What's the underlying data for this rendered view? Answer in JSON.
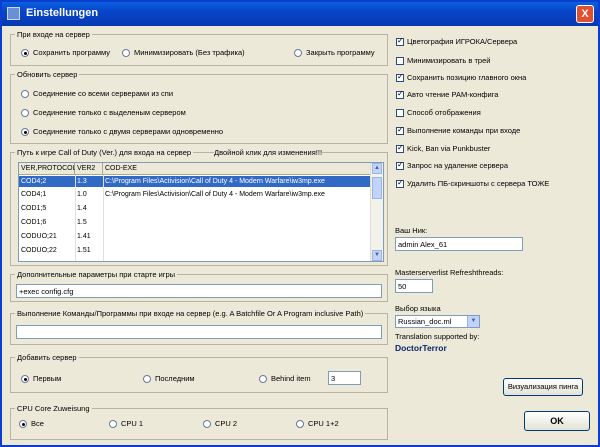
{
  "window": {
    "title": "Einstellungen",
    "close_label": "X"
  },
  "join_group": {
    "legend": "При входе на сервер",
    "options": [
      "Сохранить программу в",
      "Минимизировать (Без трафика)",
      "Закрыть программу"
    ],
    "selected": 0
  },
  "refresh_group": {
    "legend": "Обновить сервер",
    "options": [
      "Соединение со всеми серверами из спи",
      "Соединение только с выделеным сервером",
      "Соединение только с двумя серверами одновременно"
    ],
    "selected": 2
  },
  "path_group": {
    "legend": "Путь к игре Call of Duty (Ver.) для входа на сервер",
    "hint": "Двойной клик для изменения!!!",
    "columns": [
      "VER,PROTOCOL",
      "VER2",
      "COD-EXE"
    ],
    "rows": [
      [
        "COD4;2",
        "1.3",
        "C:\\Program Files\\Activision\\Call of Duty 4 - Modern Warfare\\iw3mp.exe"
      ],
      [
        "COD4;1",
        "1.0",
        "C:\\Program Files\\Activision\\Call of Duty 4 - Modern Warfare\\iw3mp.exe"
      ],
      [
        "COD1;5",
        "1.4",
        ""
      ],
      [
        "COD1;6",
        "1.5",
        ""
      ],
      [
        "CODUO;21",
        "1.41",
        ""
      ],
      [
        "CODUO;22",
        "1.51",
        ""
      ]
    ],
    "selected_row": 0
  },
  "extra_params": {
    "legend": "Дополнительные параметры при старте игры",
    "value": "+exec config.cfg"
  },
  "run_commands": {
    "legend": "Выполнение Команды/Программы при входе на сервер (e.g. A Batchfile Or A Program inclusive Path)",
    "value": ""
  },
  "add_server": {
    "legend": "Добавить сервер",
    "options": [
      "Первым",
      "Последним",
      "Behind item"
    ],
    "selected": 0,
    "behind_value": "3"
  },
  "cpu": {
    "legend": "CPU Core Zuweisung",
    "options": [
      "Все",
      "CPU 1",
      "CPU 2",
      "CPU 1+2"
    ],
    "selected": 0
  },
  "checkboxes": [
    {
      "label": "Цветография ИГРОКА/Сервера",
      "checked": true
    },
    {
      "label": "Минимизировать в трей",
      "checked": false
    },
    {
      "label": "Сохранить позицию главного окна",
      "checked": true
    },
    {
      "label": "Авто чтение РАМ-конфига",
      "checked": true
    },
    {
      "label": "Способ отображения",
      "checked": false
    },
    {
      "label": "Выполнение команды при входе",
      "checked": true
    },
    {
      "label": "Kick, Ban via Punkbuster",
      "checked": true
    },
    {
      "label": "Запрос на удаление сервера",
      "checked": true
    },
    {
      "label": "Удалить ПБ-скриншоты с сервера ТОЖЕ",
      "checked": true
    }
  ],
  "nick": {
    "label": "Ваш Ник:",
    "value": "admin Alex_61"
  },
  "threads": {
    "label": "Masterserverlist Refreshthreads:",
    "value": "50"
  },
  "language": {
    "label": "Выбор языка",
    "value": "Russian_doc.ml",
    "credit_label": "Translation supported by:",
    "credit_name": "DoctorTerror"
  },
  "buttons": {
    "visual_ping": "Визуализация пинга",
    "ok": "OK"
  }
}
